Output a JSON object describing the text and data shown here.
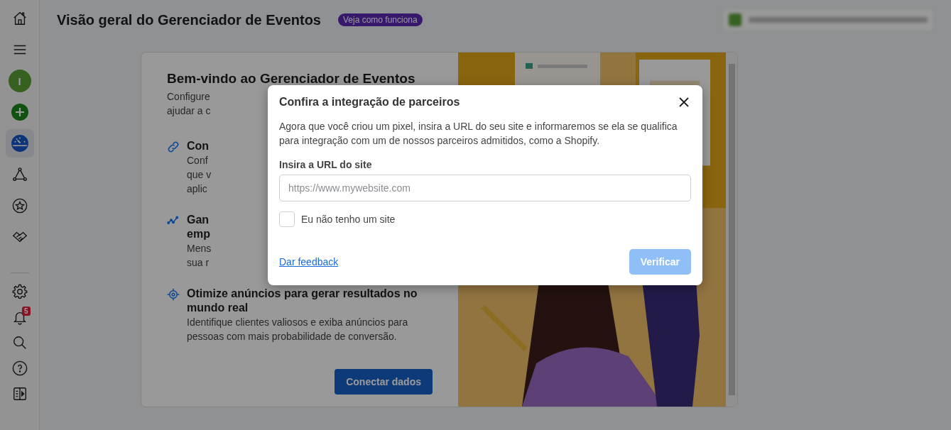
{
  "sidebar": {
    "top_items": [
      {
        "kind": "home",
        "selected": false
      },
      {
        "kind": "menu",
        "selected": false
      },
      {
        "kind": "avatar",
        "letter": "I",
        "selected": false
      },
      {
        "kind": "create",
        "selected": false
      },
      {
        "kind": "overview",
        "selected": true
      },
      {
        "kind": "network",
        "selected": false
      },
      {
        "kind": "star",
        "selected": false
      },
      {
        "kind": "handshake",
        "selected": false
      }
    ],
    "bottom_items": [
      {
        "kind": "settings",
        "selected": false
      },
      {
        "kind": "notifications",
        "badge": "5",
        "selected": false
      },
      {
        "kind": "search",
        "selected": false
      },
      {
        "kind": "help",
        "selected": false
      },
      {
        "kind": "panel",
        "selected": false
      }
    ]
  },
  "header": {
    "title": "Visão geral do Gerenciador de Eventos",
    "badge": "Veja como funciona"
  },
  "welcome_card": {
    "title": "Bem-vindo ao Gerenciador de Eventos",
    "intro_lines": [
      "Configure",
      "ajudar a c"
    ],
    "items": [
      {
        "kind": "link",
        "title_lines": [
          "Con"
        ],
        "description_lines": [
          "Conf",
          "que v",
          "aplic"
        ]
      },
      {
        "kind": "chart",
        "title_lines": [
          "Gan",
          "emp"
        ],
        "description_lines": [
          "Mens",
          "sua r"
        ]
      },
      {
        "kind": "target",
        "title_lines": [
          "Otimize anúncios para gerar resultados no",
          "mundo real"
        ],
        "description_lines": [
          "Identifique clientes valiosos e exiba anúncios para",
          "pessoas com mais probabilidade de conversão."
        ]
      }
    ],
    "button": "Conectar dados"
  },
  "dialog": {
    "title": "Confira a integração de parceiros",
    "description": "Agora que você criou um pixel, insira a URL do seu site e informaremos se ela se qualifica para integração com um de nossos parceiros admitidos, como a Shopify.",
    "field_label": "Insira a URL do site",
    "field": {
      "placeholder": "https://www.mywebsite.com"
    },
    "checkbox": {
      "label": "Eu não tenho um site",
      "checked": false
    },
    "link": "Dar feedback",
    "button": {
      "label": "Verificar",
      "disabled": true
    }
  }
}
